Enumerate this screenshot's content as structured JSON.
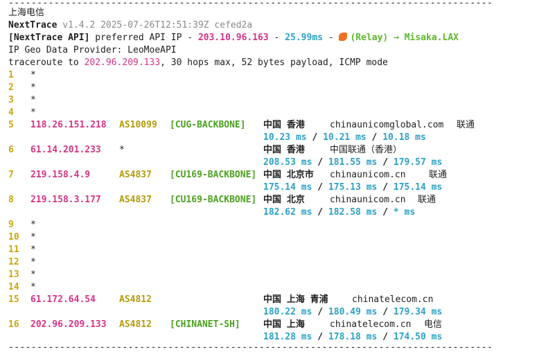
{
  "separator": "-------------------------------------------------------------------------------------",
  "isp_label": "上海电信",
  "version": {
    "name": "NextTrace",
    "details": "v1.4.2 2025-07-26T12:51:39Z cefed2a"
  },
  "api": {
    "prefix": "[NextTrace API]",
    "text": "preferred API IP -",
    "ip": "203.10.96.163",
    "dash": "-",
    "latency": "25.99ms",
    "dash2": "-",
    "relay": "(Relay) → Misaka.LAX"
  },
  "geo_provider": "IP Geo Data Provider: LeoMoeAPI",
  "traceroute": {
    "prefix": "traceroute to",
    "target": "202.96.209.133",
    "suffix": ", 30 hops max, 52 bytes payload, ICMP mode"
  },
  "hops": [
    {
      "n": "1",
      "star": "*"
    },
    {
      "n": "2",
      "star": "*"
    },
    {
      "n": "3",
      "star": "*"
    },
    {
      "n": "4",
      "star": "*"
    },
    {
      "n": "5",
      "ip": "118.26.151.218",
      "as": "AS10099",
      "tag": "[CUG-BACKBONE]",
      "geo": "中国 香港",
      "host": "chinaunicomglobal.com",
      "isp": "联通",
      "rtt": [
        "10.23 ms",
        "10.21 ms",
        "10.18 ms"
      ]
    },
    {
      "n": "6",
      "ip": "61.14.201.233",
      "as": "*",
      "tag": "",
      "geo": "中国 香港",
      "host": "中国联通（香港）",
      "isp": "",
      "rtt": [
        "208.53 ms",
        "181.55 ms",
        "179.57 ms"
      ]
    },
    {
      "n": "7",
      "ip": "219.158.4.9",
      "as": "AS4837",
      "tag": "[CU169-BACKBONE]",
      "geo": "中国 北京市",
      "host": "chinaunicom.cn",
      "isp": "联通",
      "rtt": [
        "175.14 ms",
        "175.13 ms",
        "175.14 ms"
      ]
    },
    {
      "n": "8",
      "ip": "219.158.3.177",
      "as": "AS4837",
      "tag": "[CU169-BACKBONE]",
      "geo": "中国 北京",
      "host": "chinaunicom.cn",
      "isp": "联通",
      "rtt": [
        "182.62 ms",
        "182.58 ms",
        "* ms"
      ]
    },
    {
      "n": "9",
      "star": "*"
    },
    {
      "n": "10",
      "star": "*"
    },
    {
      "n": "11",
      "star": "*"
    },
    {
      "n": "12",
      "star": "*"
    },
    {
      "n": "13",
      "star": "*"
    },
    {
      "n": "14",
      "star": "*"
    },
    {
      "n": "15",
      "ip": "61.172.64.54",
      "as": "AS4812",
      "tag": "",
      "geo": "中国 上海  青浦",
      "host": "chinatelecom.cn",
      "isp": "",
      "rtt": [
        "180.22 ms",
        "180.49 ms",
        "179.34 ms"
      ]
    },
    {
      "n": "16",
      "ip": "202.96.209.133",
      "as": "AS4812",
      "tag": "[CHINANET-SH]",
      "geo": "中国 上海",
      "host": "chinatelecom.cn",
      "isp": "电信",
      "rtt": [
        "181.28 ms",
        "178.18 ms",
        "174.50 ms"
      ]
    }
  ],
  "rtt_sep": "/",
  "colors": {
    "ip": "#d63384",
    "latency": "#2aa1c7",
    "as": "#b59a0a",
    "backbone": "#4aa11e",
    "hop_number": "#c9a70a"
  },
  "icons": {
    "relay": "fish-icon"
  }
}
